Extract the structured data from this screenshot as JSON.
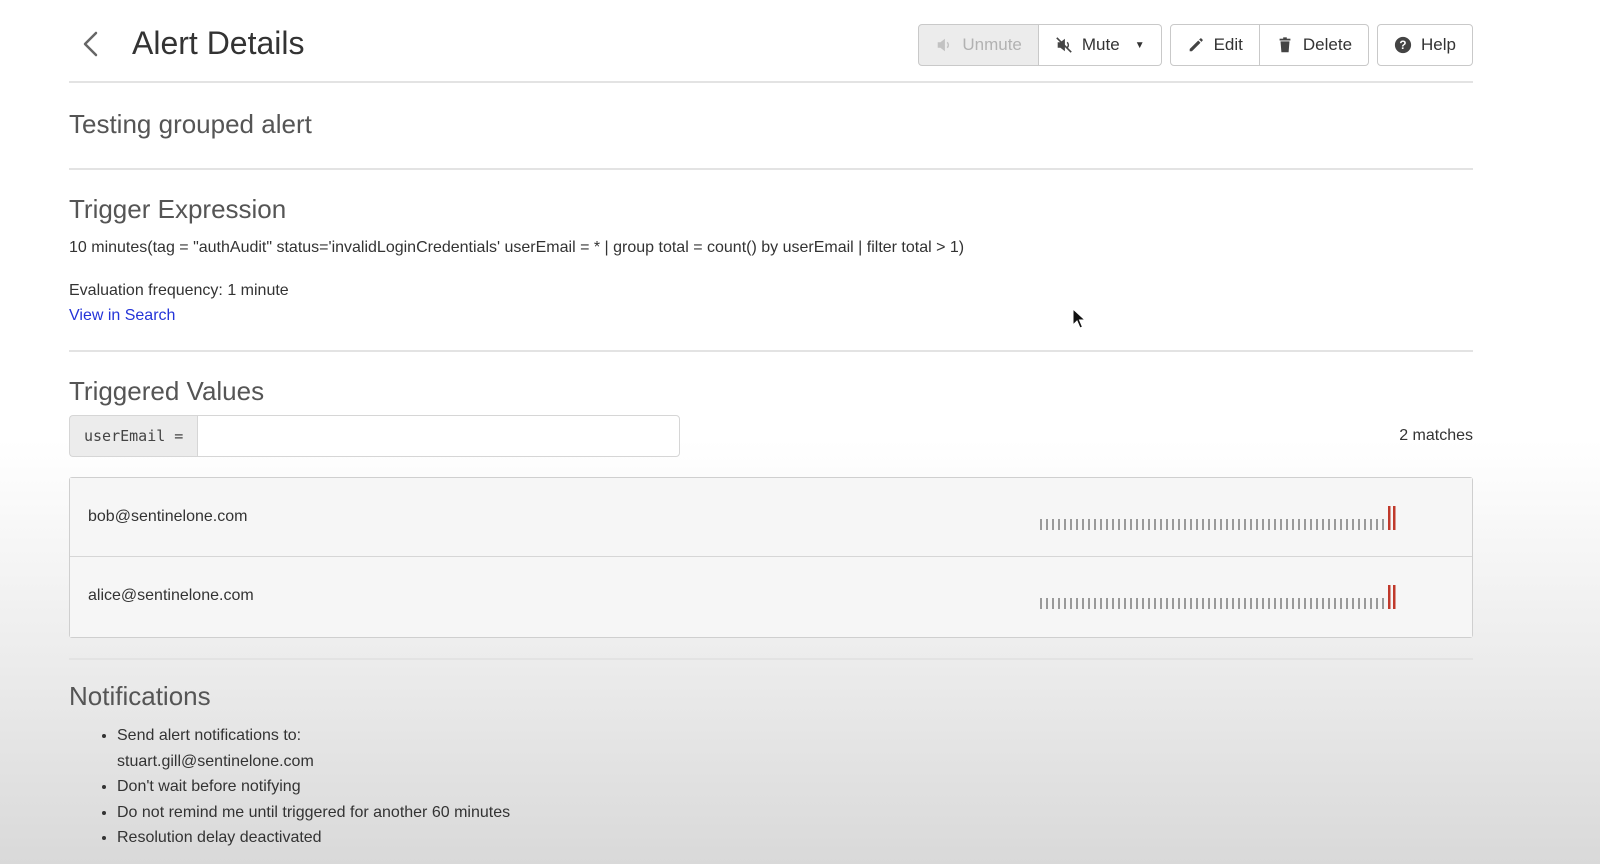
{
  "header": {
    "title": "Alert Details",
    "buttons": {
      "unmute": "Unmute",
      "mute": "Mute",
      "edit": "Edit",
      "delete": "Delete",
      "help": "Help"
    }
  },
  "alert": {
    "name": "Testing grouped alert"
  },
  "trigger": {
    "title": "Trigger Expression",
    "expression": "10 minutes(tag = \"authAudit\" status='invalidLoginCredentials' userEmail = * | group total = count() by userEmail | filter total > 1)",
    "evaluation_frequency": "Evaluation frequency: 1 minute",
    "view_in_search": "View in Search"
  },
  "triggered_values": {
    "title": "Triggered Values",
    "filter_label": "userEmail =",
    "filter_value": "",
    "match_count": "2 matches",
    "rows": [
      {
        "email": "bob@sentinelone.com"
      },
      {
        "email": "alice@sentinelone.com"
      }
    ]
  },
  "notifications": {
    "title": "Notifications",
    "items": [
      "Send alert notifications to:",
      "Don't wait before notifying",
      "Do not remind me until triggered for another 60 minutes",
      "Resolution delay deactivated"
    ],
    "recipient": "stuart.gill@sentinelone.com"
  },
  "colors": {
    "link": "#2434d8",
    "spark_normal": "#9a9a9a",
    "spark_triggered": "#c0392b"
  }
}
